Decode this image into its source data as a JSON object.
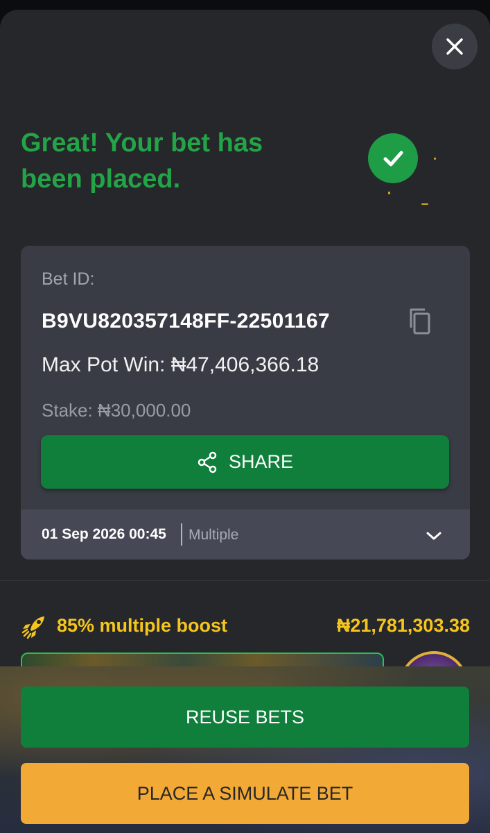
{
  "colors": {
    "brand_green": "#0f7f3b",
    "success_green": "#22a447",
    "boost_yellow": "#f5c51e",
    "simulate_orange": "#f3a935",
    "sheet_background": "#25272b",
    "card_background": "#3a3c45"
  },
  "icons": {
    "close": "close-icon",
    "success": "checkmark-circle-icon",
    "copy": "copy-icon",
    "share": "share-icon",
    "expand": "chevron-down-icon",
    "boost": "rocket-icon"
  },
  "header": {
    "title": "Great! Your bet has been placed."
  },
  "bet_card": {
    "bet_id_label": "Bet ID:",
    "bet_id": "B9VU820357148FF-22501167",
    "max_pot_win": "Max Pot Win: ₦47,406,366.18",
    "stake": "Stake: ₦30,000.00",
    "share_label": "SHARE",
    "date": "01 Sep 2026 00:45",
    "bet_type": "Multiple"
  },
  "boost": {
    "label": "85% multiple boost",
    "amount": "₦21,781,303.38"
  },
  "actions": {
    "reuse_label": "REUSE BETS",
    "simulate_label": "PLACE A SIMULATE BET"
  }
}
